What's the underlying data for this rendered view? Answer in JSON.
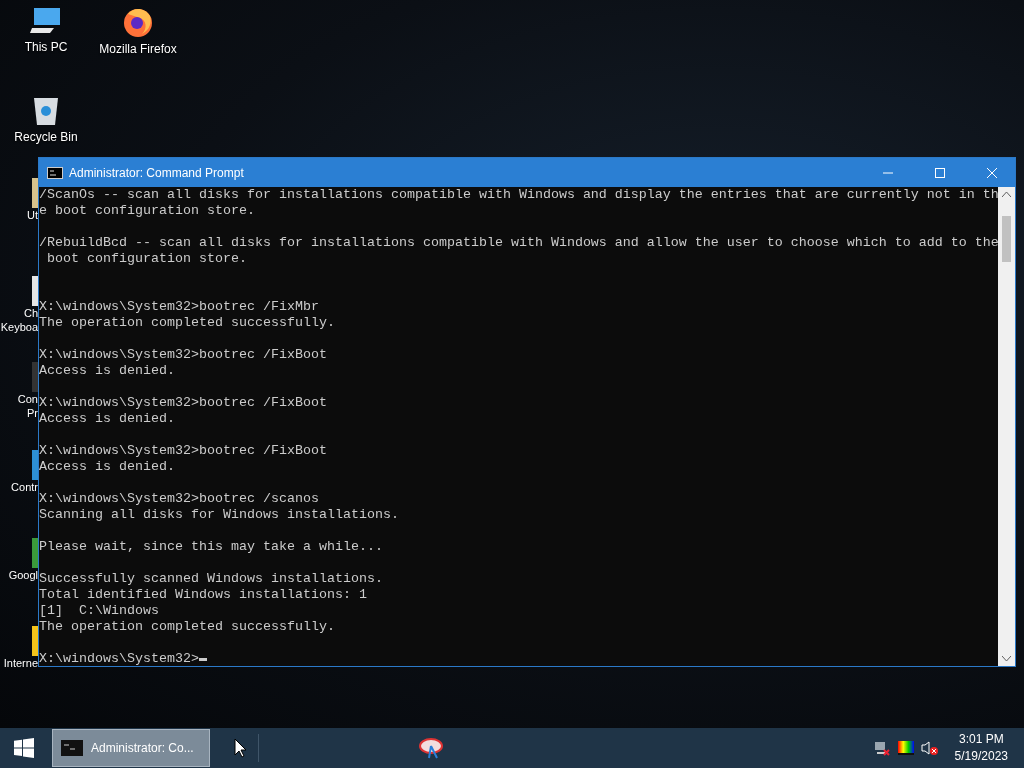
{
  "desktop": {
    "icons": [
      {
        "kind": "pc",
        "label": "This PC"
      },
      {
        "kind": "firefox",
        "label": "Mozilla Firefox"
      },
      {
        "kind": "bin",
        "label": "Recycle Bin"
      }
    ],
    "hidden_icons": [
      {
        "kind": "tool",
        "labels": [
          "Ut"
        ]
      },
      {
        "kind": "keyboard",
        "labels": [
          "Ch",
          "Keyboa"
        ]
      },
      {
        "kind": "prompt",
        "labels": [
          "Con",
          "Pr"
        ]
      },
      {
        "kind": "panel",
        "labels": [
          "Contr"
        ]
      },
      {
        "kind": "chrome",
        "labels": [
          "Googl"
        ]
      },
      {
        "kind": "ie",
        "labels": [
          "Interne"
        ]
      }
    ]
  },
  "window": {
    "title": "Administrator: Command Prompt",
    "lines": [
      {
        "kind": "text",
        "text": "/ScanOs -- scan all disks for installations compatible with Windows and display the entries that are currently not in th"
      },
      {
        "kind": "text",
        "text": "e boot configuration store."
      },
      {
        "kind": "blank"
      },
      {
        "kind": "text",
        "text": "/RebuildBcd -- scan all disks for installations compatible with Windows and allow the user to choose which to add to the"
      },
      {
        "kind": "text",
        "text": " boot configuration store."
      },
      {
        "kind": "blank"
      },
      {
        "kind": "blank"
      },
      {
        "kind": "text",
        "text": "X:\\windows\\System32>bootrec /FixMbr"
      },
      {
        "kind": "text",
        "text": "The operation completed successfully."
      },
      {
        "kind": "blank"
      },
      {
        "kind": "text",
        "text": "X:\\windows\\System32>bootrec /FixBoot"
      },
      {
        "kind": "text",
        "text": "Access is denied."
      },
      {
        "kind": "blank"
      },
      {
        "kind": "text",
        "text": "X:\\windows\\System32>bootrec /FixBoot"
      },
      {
        "kind": "text",
        "text": "Access is denied."
      },
      {
        "kind": "blank"
      },
      {
        "kind": "text",
        "text": "X:\\windows\\System32>bootrec /FixBoot"
      },
      {
        "kind": "text",
        "text": "Access is denied."
      },
      {
        "kind": "blank"
      },
      {
        "kind": "text",
        "text": "X:\\windows\\System32>bootrec /scanos"
      },
      {
        "kind": "text",
        "text": "Scanning all disks for Windows installations."
      },
      {
        "kind": "blank"
      },
      {
        "kind": "text",
        "text": "Please wait, since this may take a while..."
      },
      {
        "kind": "blank"
      },
      {
        "kind": "text",
        "text": "Successfully scanned Windows installations."
      },
      {
        "kind": "text",
        "text": "Total identified Windows installations: 1"
      },
      {
        "kind": "text",
        "text": "[1]  C:\\Windows"
      },
      {
        "kind": "text",
        "text": "The operation completed successfully."
      },
      {
        "kind": "blank"
      },
      {
        "kind": "prompt",
        "text": "X:\\windows\\System32>"
      }
    ]
  },
  "taskbar": {
    "tasks": [
      {
        "label": "Administrator: Co...",
        "selected": true
      }
    ],
    "clock": {
      "time": "3:01 PM",
      "date": "5/19/2023"
    }
  }
}
